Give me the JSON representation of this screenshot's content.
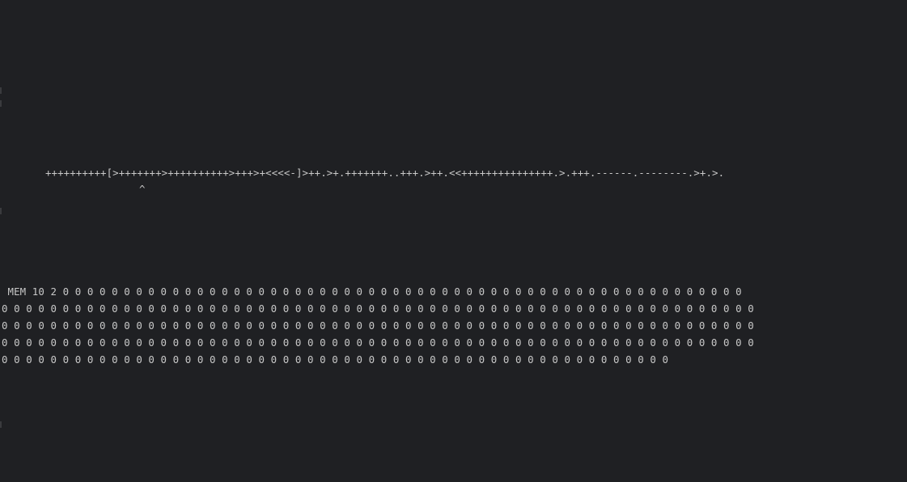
{
  "program": {
    "code": "++++++++++[>+++++++>++++++++++>+++>+<<<<-]>++.>+.+++++++..+++.>++.<<+++++++++++++++.>.+++.------.--------.>+.>.",
    "pointer": "^"
  },
  "memory": {
    "rows": [
      " MEM 10 2 0 0 0 0 0 0 0 0 0 0 0 0 0 0 0 0 0 0 0 0 0 0 0 0 0 0 0 0 0 0 0 0 0 0 0 0 0 0 0 0 0 0 0 0 0 0 0 0 0 0 0 0 0 0 0 0",
      "0 0 0 0 0 0 0 0 0 0 0 0 0 0 0 0 0 0 0 0 0 0 0 0 0 0 0 0 0 0 0 0 0 0 0 0 0 0 0 0 0 0 0 0 0 0 0 0 0 0 0 0 0 0 0 0 0 0 0 0 0 0",
      "0 0 0 0 0 0 0 0 0 0 0 0 0 0 0 0 0 0 0 0 0 0 0 0 0 0 0 0 0 0 0 0 0 0 0 0 0 0 0 0 0 0 0 0 0 0 0 0 0 0 0 0 0 0 0 0 0 0 0 0 0 0",
      "0 0 0 0 0 0 0 0 0 0 0 0 0 0 0 0 0 0 0 0 0 0 0 0 0 0 0 0 0 0 0 0 0 0 0 0 0 0 0 0 0 0 0 0 0 0 0 0 0 0 0 0 0 0 0 0 0 0 0 0 0 0",
      "0 0 0 0 0 0 0 0 0 0 0 0 0 0 0 0 0 0 0 0 0 0 0 0 0 0 0 0 0 0 0 0 0 0 0 0 0 0 0 0 0 0 0 0 0 0 0 0 0 0 0 0 0 0 0"
    ]
  },
  "colors": {
    "background": "#1f2023",
    "text": "#c8c8c8"
  }
}
